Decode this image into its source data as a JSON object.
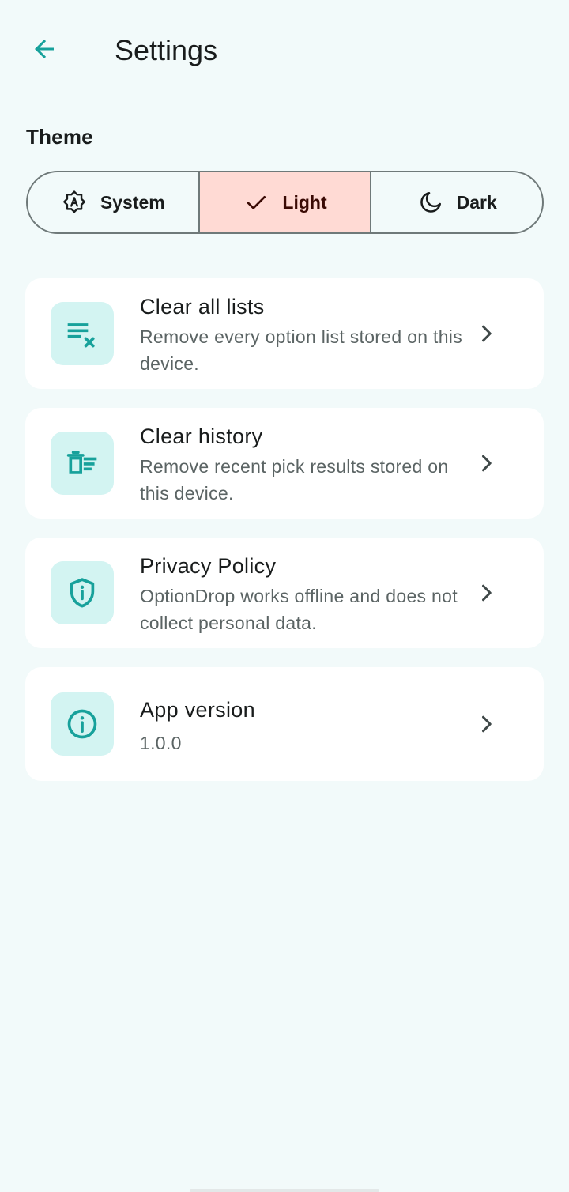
{
  "header": {
    "title": "Settings",
    "back_icon": "arrow-back-icon"
  },
  "theme": {
    "section_title": "Theme",
    "options": [
      {
        "label": "System",
        "icon": "brightness-auto-icon",
        "selected": false
      },
      {
        "label": "Light",
        "icon": "check-icon",
        "selected": true
      },
      {
        "label": "Dark",
        "icon": "moon-icon",
        "selected": false
      }
    ]
  },
  "items": [
    {
      "title": "Clear all lists",
      "subtitle": "Remove every option list stored on this device.",
      "icon": "clear-list-icon"
    },
    {
      "title": "Clear history",
      "subtitle": "Remove recent pick results stored on this device.",
      "icon": "delete-sweep-icon"
    },
    {
      "title": "Privacy Policy",
      "subtitle": "OptionDrop works offline and does not collect personal data.",
      "icon": "shield-icon"
    },
    {
      "title": "App version",
      "subtitle": "1.0.0",
      "icon": "info-icon"
    }
  ],
  "colors": {
    "accent": "#17a19b",
    "background": "#f2fafa",
    "selected_segment": "#ffdad4",
    "icon_tile": "#d3f4f2",
    "outline": "#6f7979"
  }
}
